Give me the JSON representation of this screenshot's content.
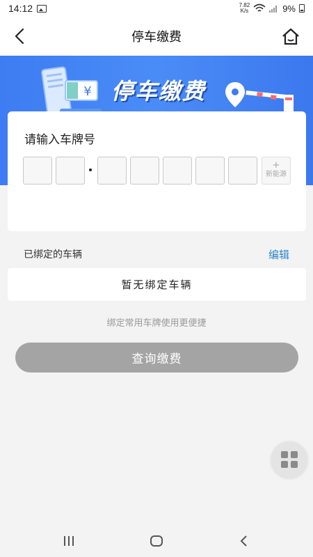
{
  "status": {
    "time": "14:12",
    "speed_top": "7.82",
    "speed_unit": "K/s",
    "battery": "9%"
  },
  "nav": {
    "title": "停车缴费"
  },
  "banner": {
    "title": "停车缴费",
    "currency": "¥"
  },
  "plate_input": {
    "label": "请输入车牌号",
    "new_energy_plus": "+",
    "new_energy_label": "新能源"
  },
  "bound": {
    "label": "已绑定的车辆",
    "edit": "编辑",
    "empty": "暂无绑定车辆",
    "hint": "绑定常用车牌使用更便捷"
  },
  "actions": {
    "query": "查询缴费"
  },
  "colors": {
    "accent_blue": "#3d7cf2",
    "link": "#2f86c9",
    "disabled_button": "#a4a4a4"
  }
}
